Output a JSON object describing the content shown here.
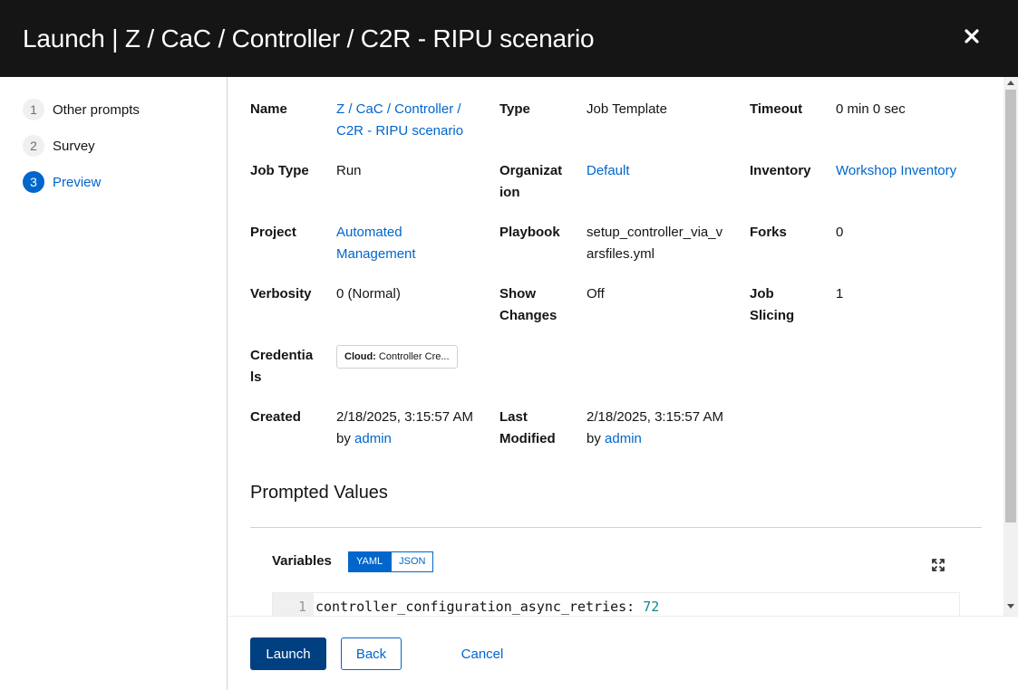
{
  "modal": {
    "title": "Launch | Z / CaC / Controller / C2R - RIPU scenario"
  },
  "wizard": {
    "steps": [
      {
        "number": "1",
        "label": "Other prompts"
      },
      {
        "number": "2",
        "label": "Survey"
      },
      {
        "number": "3",
        "label": "Preview"
      }
    ],
    "active_step": "Preview"
  },
  "details": {
    "name_label": "Name",
    "name_value_line1": "Z / CaC / Controller /",
    "name_value_line2": "C2R - RIPU scenario",
    "type_label": "Type",
    "type_value": "Job Template",
    "timeout_label": "Timeout",
    "timeout_value": "0 min 0 sec",
    "job_type_label": "Job Type",
    "job_type_value": "Run",
    "organization_label_line1": "Organizat",
    "organization_label_line2": "ion",
    "organization_value": "Default",
    "inventory_label": "Inventory",
    "inventory_value": "Workshop Inventory",
    "project_label": "Project",
    "project_value_line1": "Automated",
    "project_value_line2": "Management",
    "playbook_label": "Playbook",
    "playbook_value_line1": "setup_controller_via_v",
    "playbook_value_line2": "arsfiles.yml",
    "forks_label": "Forks",
    "forks_value": "0",
    "verbosity_label": "Verbosity",
    "verbosity_value": "0 (Normal)",
    "show_changes_label_line1": "Show",
    "show_changes_label_line2": "Changes",
    "show_changes_value": "Off",
    "job_slicing_label_line1": "Job",
    "job_slicing_label_line2": "Slicing",
    "job_slicing_value": "1",
    "credentials_label_line1": "Credentia",
    "credentials_label_line2": "ls",
    "credential_chip_kind": "Cloud:",
    "credential_chip_name": "Controller Cre...",
    "created_label": "Created",
    "created_value": "2/18/2025, 3:15:57 AM",
    "created_by_prefix": "by",
    "created_by_user": "admin",
    "last_modified_label_line1": "Last",
    "last_modified_label_line2": "Modified",
    "last_modified_value": "2/18/2025, 3:15:57 AM",
    "modified_by_prefix": "by",
    "modified_by_user": "admin"
  },
  "prompted_values": {
    "title": "Prompted Values",
    "variables_label": "Variables",
    "toggle": {
      "yaml": "YAML",
      "json": "JSON",
      "selected": "YAML"
    },
    "editor": {
      "line_number": "1",
      "key": "controller_configuration_async_retries:",
      "value": "72"
    }
  },
  "footer": {
    "launch_label": "Launch",
    "back_label": "Back",
    "cancel_label": "Cancel"
  },
  "colors": {
    "header_bg": "#151515",
    "link": "#0066cc",
    "primary_button": "#004080",
    "code_number": "#0b8a8a"
  },
  "icons": {
    "close": "close-icon",
    "expand": "expand-icon"
  }
}
